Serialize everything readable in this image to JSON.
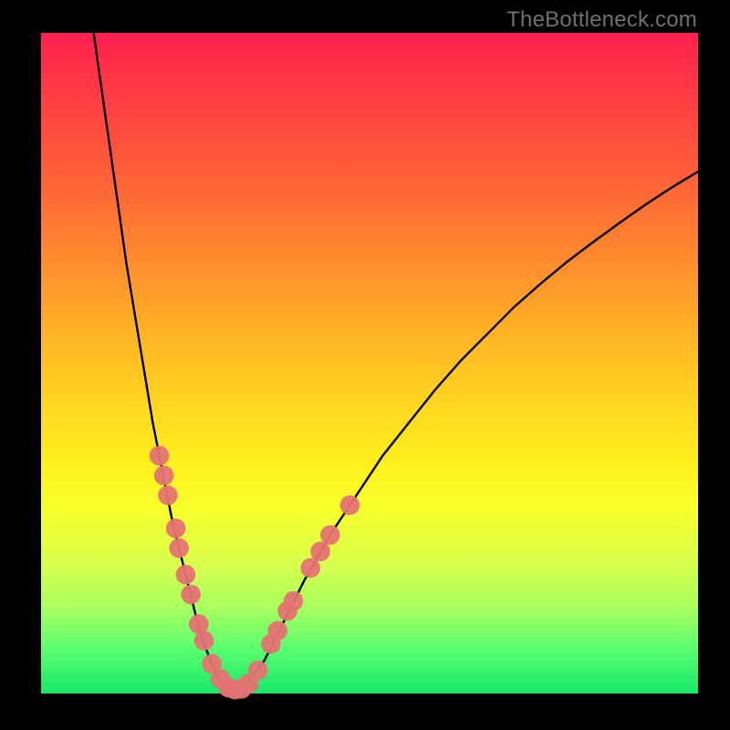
{
  "watermark": "TheBottleneck.com",
  "chart_data": {
    "type": "line",
    "title": "",
    "xlabel": "",
    "ylabel": "",
    "xlim": [
      0,
      100
    ],
    "ylim": [
      0,
      100
    ],
    "grid": false,
    "series": [
      {
        "name": "bottleneck-curve",
        "x": [
          8,
          9,
          10,
          11,
          12,
          13,
          14,
          15,
          16,
          17,
          18,
          19,
          20,
          21,
          22,
          23,
          24,
          25,
          26,
          27,
          28,
          29,
          30,
          31,
          32,
          34,
          36,
          38,
          40,
          44,
          48,
          52,
          56,
          60,
          64,
          68,
          72,
          76,
          80,
          84,
          88,
          92,
          96,
          100
        ],
        "values": [
          100,
          93,
          86,
          79,
          72,
          65,
          59,
          53,
          47,
          41,
          36,
          31,
          26,
          22,
          18,
          14,
          10,
          7,
          4.5,
          2.5,
          1.2,
          0.6,
          0.6,
          1.2,
          2.5,
          5,
          9,
          13,
          17,
          24,
          30,
          36,
          41,
          46,
          50.5,
          54.5,
          58.5,
          62,
          65.3,
          68.3,
          71.2,
          74,
          76.6,
          79
        ]
      }
    ],
    "markers": {
      "name": "data-points",
      "color": "#e57373",
      "radius_pct": 1.5,
      "points": [
        {
          "x": 18.0,
          "y": 36.0
        },
        {
          "x": 18.7,
          "y": 33.0
        },
        {
          "x": 19.3,
          "y": 30.0
        },
        {
          "x": 20.5,
          "y": 25.0
        },
        {
          "x": 21.0,
          "y": 22.0
        },
        {
          "x": 22.0,
          "y": 18.0
        },
        {
          "x": 22.8,
          "y": 15.0
        },
        {
          "x": 24.0,
          "y": 10.5
        },
        {
          "x": 24.8,
          "y": 8.0
        },
        {
          "x": 26.0,
          "y": 4.5
        },
        {
          "x": 27.3,
          "y": 2.2
        },
        {
          "x": 28.5,
          "y": 0.9
        },
        {
          "x": 29.5,
          "y": 0.6
        },
        {
          "x": 30.5,
          "y": 0.7
        },
        {
          "x": 31.6,
          "y": 1.5
        },
        {
          "x": 33.0,
          "y": 3.5
        },
        {
          "x": 35.0,
          "y": 7.5
        },
        {
          "x": 36.0,
          "y": 9.5
        },
        {
          "x": 37.5,
          "y": 12.5
        },
        {
          "x": 38.4,
          "y": 14.0
        },
        {
          "x": 41.0,
          "y": 19.0
        },
        {
          "x": 42.5,
          "y": 21.5
        },
        {
          "x": 44.0,
          "y": 24.0
        },
        {
          "x": 47.0,
          "y": 28.5
        }
      ]
    },
    "background_gradient": {
      "direction": "vertical",
      "stops": [
        {
          "pct": 0,
          "color": "#ff1f4e"
        },
        {
          "pct": 20,
          "color": "#ff5a3a"
        },
        {
          "pct": 47,
          "color": "#ffb824"
        },
        {
          "pct": 66,
          "color": "#fff21e"
        },
        {
          "pct": 87,
          "color": "#a8ff5f"
        },
        {
          "pct": 100,
          "color": "#17e869"
        }
      ]
    }
  }
}
